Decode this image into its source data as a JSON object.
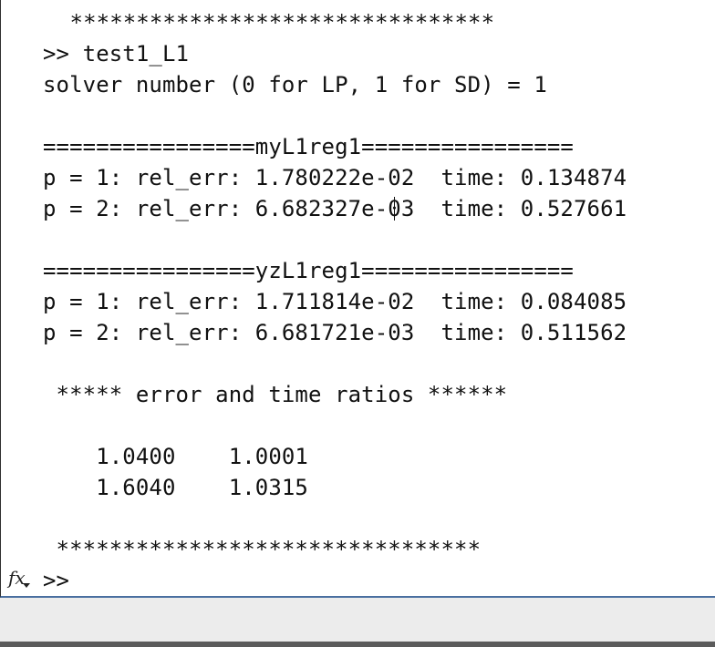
{
  "console": {
    "lines": [
      " ********************************",
      ">> test1_L1",
      "solver number (0 for LP, 1 for SD) = 1",
      "",
      "================myL1reg1================",
      "p = 1: rel_err: 1.780222e-02  time: 0.134874",
      "p = 2: rel_err: 6.682327e-03  time: 0.527661",
      "",
      "================yzL1reg1================",
      "p = 1: rel_err: 1.711814e-02  time: 0.084085",
      "p = 2: rel_err: 6.681721e-03  time: 0.511562",
      "",
      " ***** error and time ratios ******",
      "",
      "    1.0400    1.0001",
      "    1.6040    1.0315",
      "",
      "",
      " ********************************"
    ],
    "prompt": ">>"
  },
  "colors": {
    "text": "#111111",
    "background": "#ffffff",
    "statusbar": "#ececec",
    "border": "#4a6fa0"
  },
  "icons": {
    "function_browser": "fx-icon"
  }
}
